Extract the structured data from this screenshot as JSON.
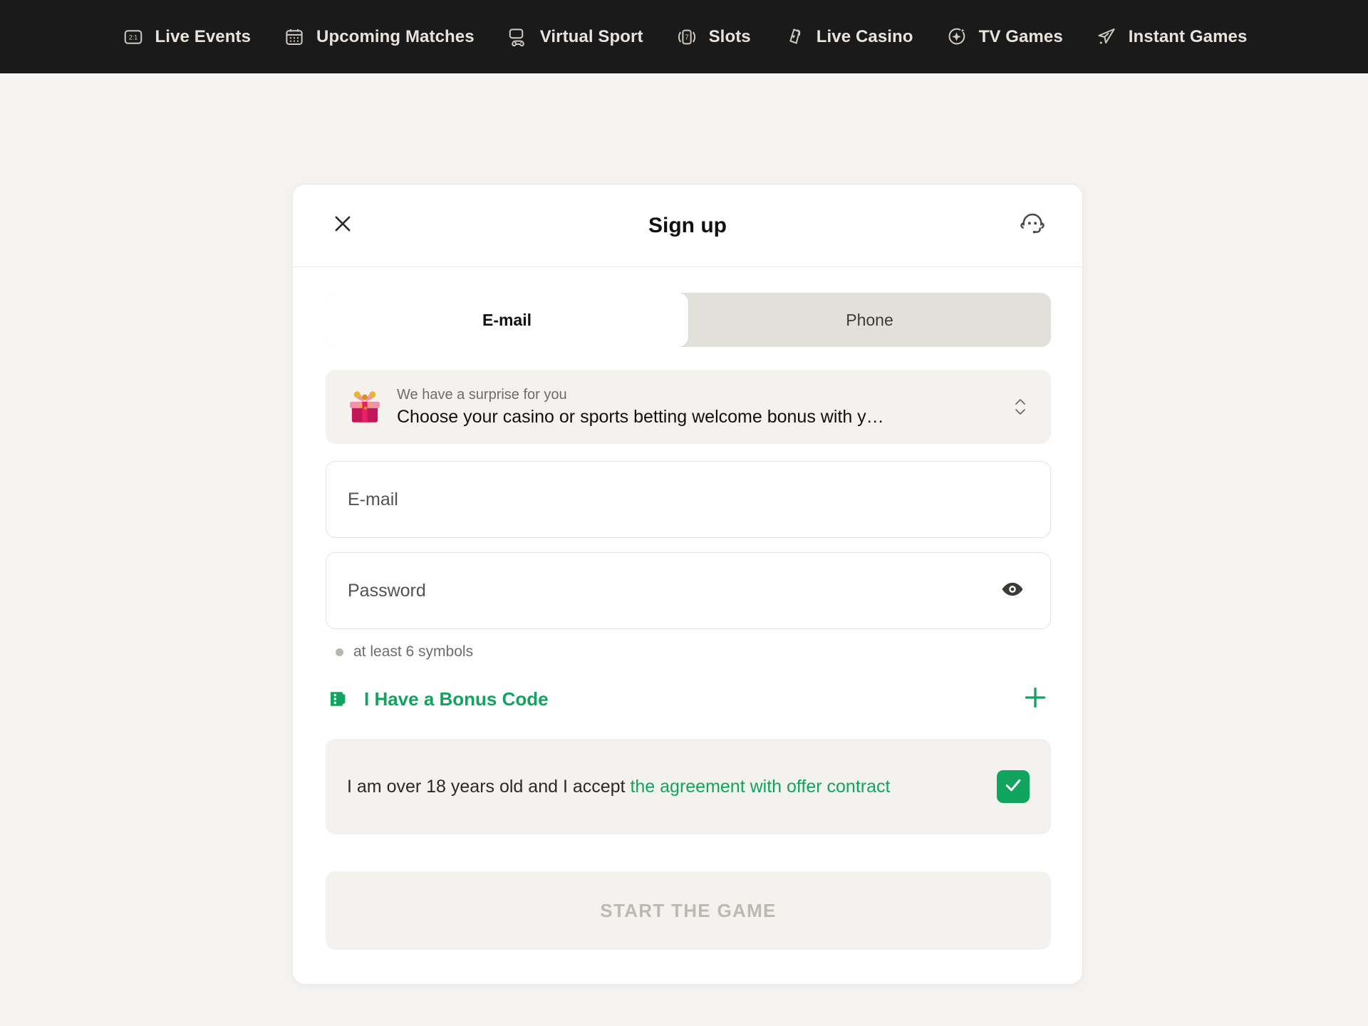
{
  "topnav": {
    "items": [
      {
        "label": "Live Events",
        "icon": "live-events-icon"
      },
      {
        "label": "Upcoming Matches",
        "icon": "calendar-icon"
      },
      {
        "label": "Virtual Sport",
        "icon": "virtual-sport-icon"
      },
      {
        "label": "Slots",
        "icon": "slots-icon"
      },
      {
        "label": "Live Casino",
        "icon": "live-casino-cards-icon"
      },
      {
        "label": "TV Games",
        "icon": "tv-games-sparkle-icon"
      },
      {
        "label": "Instant Games",
        "icon": "rocket-icon"
      }
    ]
  },
  "modal": {
    "title": "Sign up",
    "close_icon": "close-icon",
    "support_icon": "support-headset-icon",
    "tabs": [
      {
        "label": "E-mail",
        "active": true
      },
      {
        "label": "Phone",
        "active": false
      }
    ],
    "bonus_banner": {
      "icon": "gift-box-icon",
      "eyebrow": "We have a surprise for you",
      "title": "Choose your casino or sports betting welcome bonus with y…",
      "stepper_icon": "chevron-up-down-icon"
    },
    "email_field": {
      "placeholder": "E-mail",
      "value": ""
    },
    "password_field": {
      "placeholder": "Password",
      "value": "",
      "toggle_icon": "eye-icon"
    },
    "password_hint": "at least 6 symbols",
    "bonus_code": {
      "label": "I Have a Bonus Code",
      "icon": "ticket-icon",
      "add_icon": "plus-icon"
    },
    "agreement": {
      "text_plain": "I am over 18 years old and I accept ",
      "text_link": "the agreement with offer contract",
      "checked": true,
      "check_icon": "check-icon"
    },
    "submit_label": "START THE GAME"
  },
  "colors": {
    "accent_green": "#10a45e",
    "nav_background": "#1a1a1a",
    "page_background": "#f4f3f1",
    "modal_background": "#ffffff",
    "muted_text": "#6f6c68",
    "disabled_text": "#bdb8b0"
  }
}
